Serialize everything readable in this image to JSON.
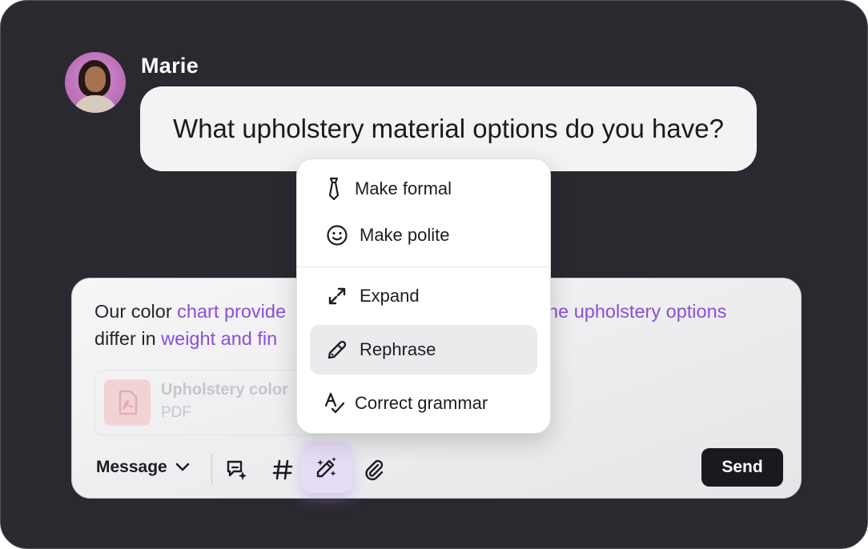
{
  "message": {
    "author": "Marie",
    "text": "What upholstery material options do you have?"
  },
  "composer": {
    "text_parts": [
      {
        "text": "Our color ",
        "style": "normal"
      },
      {
        "text": "chart provide",
        "style": "highlight"
      },
      {
        "text": ". The upholstery options",
        "style": "highlight"
      },
      {
        "text": "differ in ",
        "style": "normal"
      },
      {
        "text": "weight and fin",
        "style": "highlight"
      }
    ],
    "attachment": {
      "name": "Upholstery color",
      "type": "PDF"
    },
    "mode_label": "Message",
    "send_label": "Send"
  },
  "toolbar": {
    "icons": [
      "chat-sparkle-icon",
      "hashtag-icon",
      "magic-wand-icon",
      "paperclip-icon"
    ],
    "active": "magic-wand-icon"
  },
  "ai_menu": {
    "items": [
      {
        "label": "Make formal",
        "icon": "necktie-icon"
      },
      {
        "label": "Make polite",
        "icon": "smiley-icon"
      },
      {
        "label": "Expand",
        "icon": "expand-arrows-icon"
      },
      {
        "label": "Rephrase",
        "icon": "pencil-icon",
        "selected": true
      },
      {
        "label": "Correct grammar",
        "icon": "grammar-check-icon"
      }
    ]
  },
  "colors": {
    "frame_background": "#2a2930",
    "highlight_text": "#8a4fd6",
    "active_tool_background": "#e7dcf7",
    "send_button": "#1a191f"
  }
}
